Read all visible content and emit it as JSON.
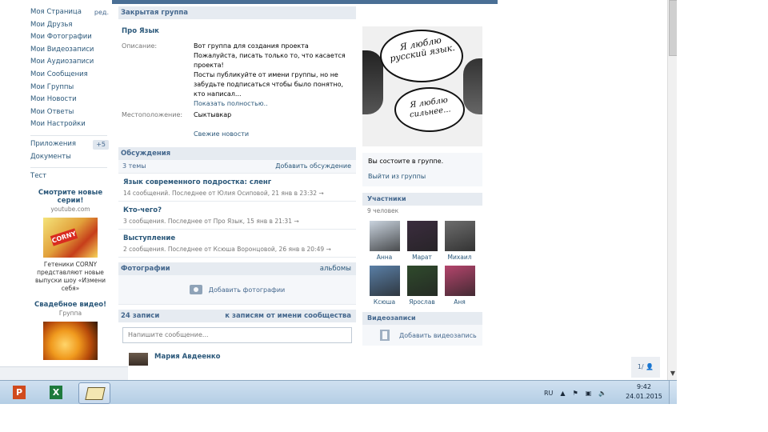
{
  "left_menu": {
    "items": [
      {
        "label": "Моя Страница",
        "badge": "ред."
      },
      {
        "label": "Мои Друзья"
      },
      {
        "label": "Мои Фотографии"
      },
      {
        "label": "Мои Видеозаписи"
      },
      {
        "label": "Мои Аудиозаписи"
      },
      {
        "label": "Мои Сообщения"
      },
      {
        "label": "Мои Группы"
      },
      {
        "label": "Мои Новости"
      },
      {
        "label": "Мои Ответы"
      },
      {
        "label": "Мои Настройки"
      }
    ],
    "items2": [
      {
        "label": "Приложения",
        "badge": "+5"
      },
      {
        "label": "Документы"
      }
    ],
    "items3": [
      {
        "label": "Тест"
      }
    ]
  },
  "ads": {
    "ad1_title": "Смотрите новые серии!",
    "ad1_site": "youtube.com",
    "ad1_logo": "CORNY",
    "ad1_text": "Гетеники CORNY представляют новые выпуски шоу «Измени себя»",
    "ad2_title": "Свадебное видео!",
    "ad2_site": "Группа"
  },
  "main": {
    "closed_group_label": "Закрытая группа",
    "info_title": "Про Язык",
    "description_label": "Описание:",
    "description_lines": [
      "Вот группа для создания проекта",
      "Пожалуйста, писать только то, что касается проекта!",
      "Посты публикуйте от имени группы, но не забудьте подписаться чтобы было понятно, кто написал..."
    ],
    "show_full": "Показать полностью..",
    "location_label": "Местоположение:",
    "location_value": "Сыктывкар",
    "fresh_news": "Свежие новости",
    "discussions": {
      "header": "Обсуждения",
      "count": "3 темы",
      "add": "Добавить обсуждение",
      "topics": [
        {
          "title": "Язык современного подростка: сленг",
          "meta": "14 сообщений. Последнее от Юлия Осиповой, 21 янв в 23:32 →"
        },
        {
          "title": "Кто-чего?",
          "meta": "3 сообщения. Последнее от Про Язык, 15 янв в 21:31 →"
        },
        {
          "title": "Выступление",
          "meta": "2 сообщения. Последнее от Ксюша Воронцовой, 26 янв в 20:49 →"
        }
      ]
    },
    "photos": {
      "header": "Фотографии",
      "albums": "альбомы",
      "add": "Добавить фотографии"
    },
    "wall": {
      "count": "24 записи",
      "by_community": "к записям от имени сообщества",
      "placeholder": "Напишите сообщение...",
      "first_post_author": "Мария Авдеенко"
    }
  },
  "right": {
    "cover_text_1": "Я люблю русский язык.",
    "cover_text_2": "Я люблю сильнее...",
    "member_status": "Вы состоите в группе.",
    "leave": "Выйти из группы",
    "members_header": "Участники",
    "members_count": "9 человек",
    "members": [
      {
        "name": "Анна",
        "color": "#c9d3de"
      },
      {
        "name": "Марат",
        "color": "#3b2c3e"
      },
      {
        "name": "Михаил",
        "color": "#6d6d6d"
      },
      {
        "name": "Ксюша",
        "color": "#5a7fa6"
      },
      {
        "name": "Ярослав",
        "color": "#2f4a2c"
      },
      {
        "name": "Аня",
        "color": "#b4456c"
      }
    ],
    "videos_header": "Видеозаписи",
    "add_video": "Добавить видеозапись"
  },
  "counter": "1/ 👤",
  "taskbar": {
    "apps": [
      "P",
      "X",
      "book"
    ],
    "tray_lang": "RU",
    "time": "9:42",
    "date": "24.01.2015"
  }
}
